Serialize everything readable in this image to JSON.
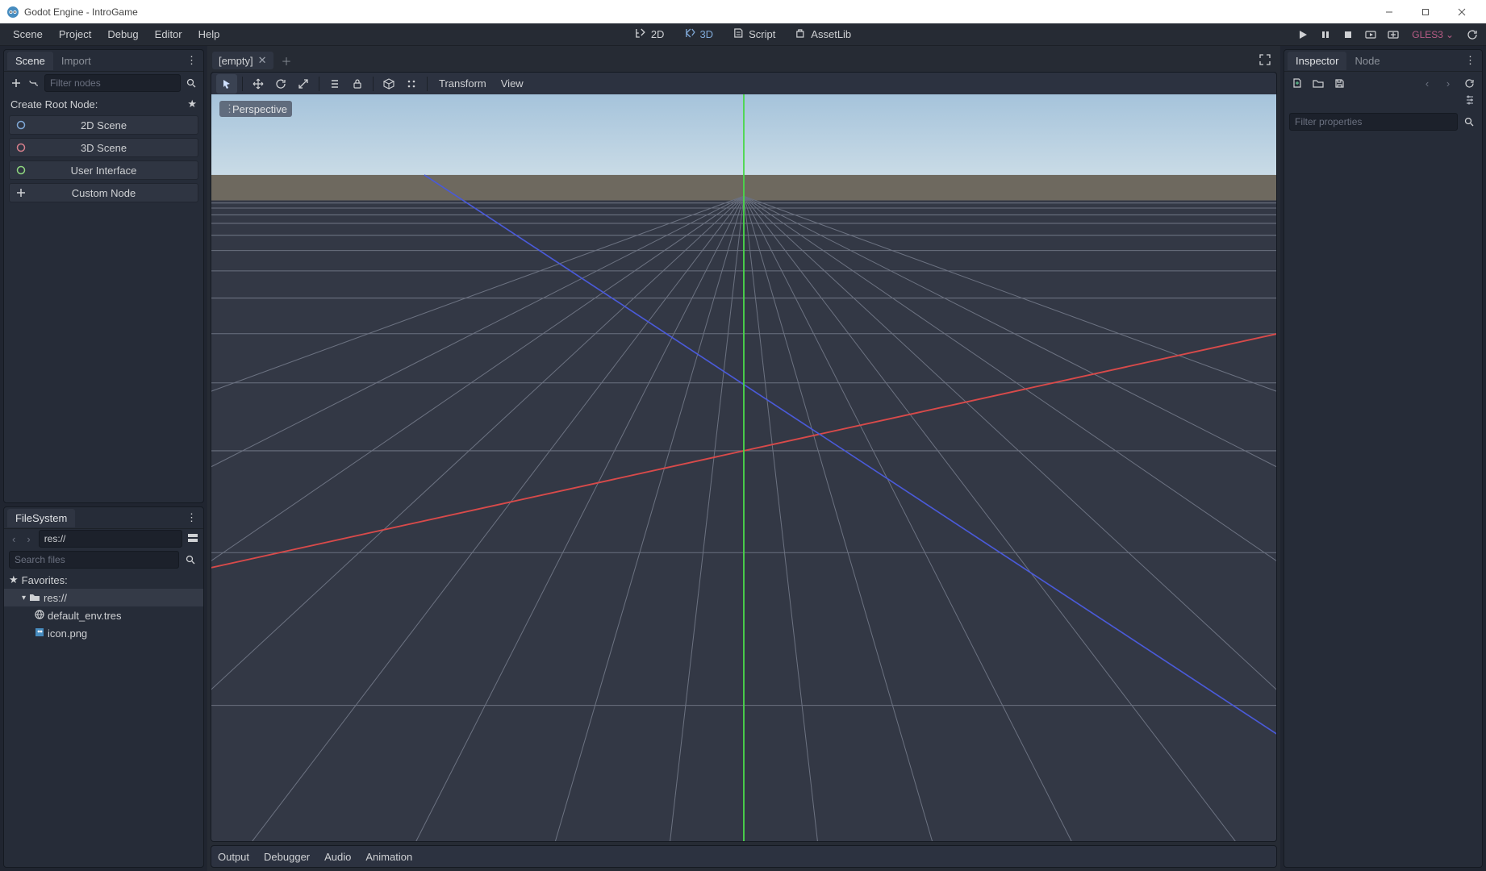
{
  "os_titlebar": {
    "title": "Godot Engine - IntroGame"
  },
  "menubar": {
    "items": [
      "Scene",
      "Project",
      "Debug",
      "Editor",
      "Help"
    ],
    "workspaces": {
      "w2d": "2D",
      "w3d": "3D",
      "script": "Script",
      "assetlib": "AssetLib"
    },
    "renderer": "GLES3"
  },
  "left": {
    "scene_tabs": {
      "scene": "Scene",
      "import": "Import"
    },
    "filter_placeholder": "Filter nodes",
    "create_root_label": "Create Root Node:",
    "root_buttons": {
      "scene2d": "2D Scene",
      "scene3d": "3D Scene",
      "ui": "User Interface",
      "custom": "Custom Node"
    },
    "fs": {
      "title": "FileSystem",
      "path": "res://",
      "search_placeholder": "Search files",
      "favorites": "Favorites:",
      "root": "res://",
      "files": [
        "default_env.tres",
        "icon.png"
      ]
    }
  },
  "center": {
    "scene_tab_label": "[empty]",
    "toolbar": {
      "transform": "Transform",
      "view": "View"
    },
    "perspective": "Perspective",
    "bottom_tabs": [
      "Output",
      "Debugger",
      "Audio",
      "Animation"
    ]
  },
  "right": {
    "tabs": {
      "inspector": "Inspector",
      "node": "Node"
    },
    "filter_placeholder": "Filter properties"
  }
}
